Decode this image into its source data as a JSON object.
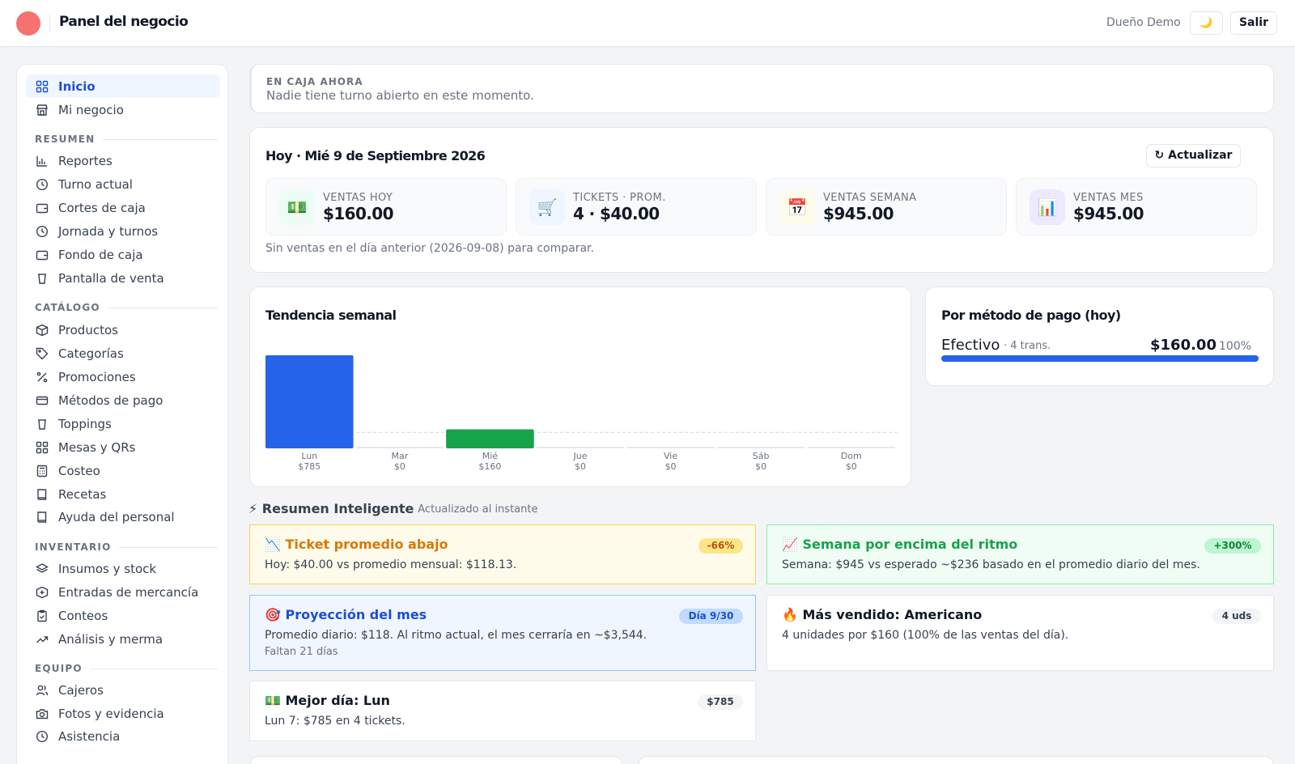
{
  "header": {
    "title": "Panel del negocio",
    "user": "Dueño Demo",
    "theme_icon": "🌙",
    "logout_label": "Salir",
    "brand_color": "#f87171"
  },
  "sidebar": {
    "items": [
      {
        "label": "Inicio",
        "icon": "grid-icon",
        "active": true
      },
      {
        "label": "Mi negocio",
        "icon": "store-icon"
      }
    ],
    "sections": [
      {
        "title": "RESUMEN",
        "items": [
          {
            "label": "Reportes",
            "icon": "bar-chart-icon"
          },
          {
            "label": "Turno actual",
            "icon": "clock-icon"
          },
          {
            "label": "Cortes de caja",
            "icon": "wallet-icon"
          },
          {
            "label": "Jornada y turnos",
            "icon": "clock-icon"
          },
          {
            "label": "Fondo de caja",
            "icon": "wallet-icon"
          },
          {
            "label": "Pantalla de venta",
            "icon": "cup-icon"
          }
        ]
      },
      {
        "title": "CATÁLOGO",
        "items": [
          {
            "label": "Productos",
            "icon": "box-icon"
          },
          {
            "label": "Categorías",
            "icon": "tag-icon"
          },
          {
            "label": "Promociones",
            "icon": "percent-icon"
          },
          {
            "label": "Métodos de pago",
            "icon": "credit-card-icon"
          },
          {
            "label": "Toppings",
            "icon": "cup-icon"
          },
          {
            "label": "Mesas y QRs",
            "icon": "grid-icon"
          },
          {
            "label": "Costeo",
            "icon": "calculator-icon"
          },
          {
            "label": "Recetas",
            "icon": "book-icon"
          },
          {
            "label": "Ayuda del personal",
            "icon": "book-icon"
          }
        ]
      },
      {
        "title": "INVENTARIO",
        "items": [
          {
            "label": "Insumos y stock",
            "icon": "layers-icon"
          },
          {
            "label": "Entradas de mercancía",
            "icon": "package-plus-icon"
          },
          {
            "label": "Conteos",
            "icon": "clipboard-check-icon"
          },
          {
            "label": "Análisis y merma",
            "icon": "trending-up-icon"
          }
        ]
      },
      {
        "title": "EQUIPO",
        "items": [
          {
            "label": "Cajeros",
            "icon": "users-icon"
          },
          {
            "label": "Fotos y evidencia",
            "icon": "camera-icon"
          },
          {
            "label": "Asistencia",
            "icon": "clock-icon"
          }
        ]
      }
    ]
  },
  "caja": {
    "label": "EN CAJA AHORA",
    "text": "Nadie tiene turno abierto en este momento."
  },
  "today": {
    "title": "Hoy · Mié 9 de Septiembre 2026",
    "refresh_label": "↻ Actualizar",
    "stats": [
      {
        "label": "VENTAS HOY",
        "value": "$160.00",
        "icon": "💵",
        "bg": "#ecfdf5"
      },
      {
        "label": "TICKETS · PROM.",
        "value": "4 · $40.00",
        "icon": "🛒",
        "bg": "#eff6ff"
      },
      {
        "label": "VENTAS SEMANA",
        "value": "$945.00",
        "icon": "📅",
        "bg": "#fffbeb"
      },
      {
        "label": "VENTAS MES",
        "value": "$945.00",
        "icon": "📊",
        "bg": "#ede9fe"
      }
    ],
    "compare_note": "Sin ventas en el día anterior (2026-09-08) para comparar."
  },
  "weekly": {
    "title": "Tendencia semanal",
    "chart_data": {
      "type": "bar",
      "categories": [
        "Lun",
        "Mar",
        "Mié",
        "Jue",
        "Vie",
        "Sáb",
        "Dom"
      ],
      "values": [
        785,
        0,
        160,
        0,
        0,
        0,
        0
      ],
      "value_labels": [
        "$785",
        "$0",
        "$160",
        "$0",
        "$0",
        "$0",
        "$0"
      ],
      "average_line": 135,
      "colors": {
        "default": "#2563eb",
        "today": "#16a34a",
        "empty": "#e5e7eb"
      },
      "today_index": 2,
      "ylim": [
        0,
        785
      ]
    }
  },
  "payment": {
    "title": "Por método de pago (hoy)",
    "method": "Efectivo",
    "trans": "· 4 trans.",
    "amount": "$160.00",
    "pct": "100%",
    "fill_fraction": 1.0,
    "color": "#2563eb"
  },
  "smart": {
    "title": "⚡ Resumen Inteligente",
    "subtitle": "· Actualizado al instante",
    "insights": [
      {
        "title": "📉 Ticket promedio abajo",
        "badge": "-66%",
        "text": "Hoy: $40.00 vs promedio mensual: $118.13.",
        "sub": ""
      },
      {
        "title": "📈 Semana por encima del ritmo",
        "badge": "+300%",
        "text": "Semana: $945 vs esperado ~$236 basado en el promedio diario del mes.",
        "sub": ""
      },
      {
        "title": "🎯 Proyección del mes",
        "badge": "Día 9/30",
        "text": "Promedio diario: $118. Al ritmo actual, el mes cerraría en ~$3,544.",
        "sub": "Faltan 21 días"
      },
      {
        "title": "🔥 Más vendido: Americano",
        "badge": "4 uds",
        "text": "4 unidades por $160 (100% de las ventas del día).",
        "sub": ""
      },
      {
        "title": "💵 Mejor día: Lun",
        "badge": "$785",
        "text": "Lun 7: $785 en 4 tickets.",
        "sub": ""
      }
    ]
  }
}
